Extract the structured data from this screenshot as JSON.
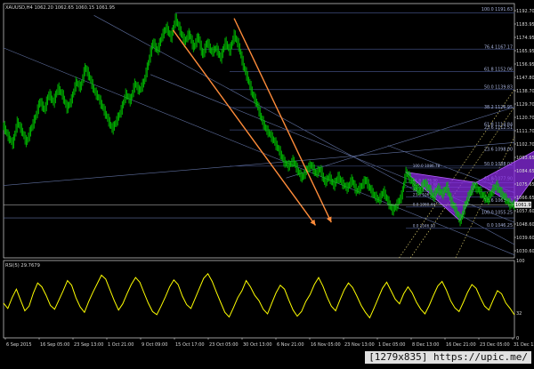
{
  "symbol_header": "XAUUSD,H4 1062.20 1062.65 1060.15 1061.95",
  "rsi_header": "RSI(5) 29.7679",
  "last_price": "1061.95",
  "watermark": "[1279x835] https://upic.me/",
  "colors": {
    "background": "#000000",
    "candle": "#00c000",
    "price_frame": "#d8d8d8",
    "rsi_line": "#ffff00",
    "fib_line": "#3d4a7a",
    "fib_label": "#a9b4dd",
    "trend_line": "#5f6f9f",
    "arrow": "#ff8c3a",
    "pattern_fill": "#8a2be2",
    "pattern_edge": "#b55cff",
    "prz_box": "#0014ff",
    "dotted_channel": "#d2c46a"
  },
  "chart_data": [
    {
      "type": "candlestick",
      "title": "XAUUSD,H4",
      "header_values": {
        "open": 1062.2,
        "high": 1062.65,
        "low": 1060.15,
        "close": 1061.95
      },
      "x_tick_labels": [
        "6 Sep 2015",
        "16 Sep 05:00",
        "23 Sep 13:00",
        "1 Oct 21:00",
        "9 Oct 09:00",
        "15 Oct 17:00",
        "23 Oct 05:00",
        "30 Oct 13:00",
        "6 Nov 21:00",
        "16 Nov 05:00",
        "23 Nov 13:00",
        "1 Dec 05:00",
        "8 Dec 13:00",
        "16 Dec 21:00",
        "23 Dec 05:00",
        "31 Dec 13:00"
      ],
      "y_tick_labels": [
        "1192.70",
        "1183.95",
        "1174.95",
        "1165.95",
        "1156.95",
        "1147.80",
        "1138.70",
        "1129.70",
        "1120.70",
        "1111.70",
        "1102.70",
        "1093.65",
        "1084.65",
        "1075.65",
        "1066.65",
        "1057.60",
        "1048.60",
        "1039.60",
        "1030.60"
      ],
      "ylim": [
        1026,
        1198
      ],
      "close_path": [
        [
          0,
          1115
        ],
        [
          4,
          1108
        ],
        [
          8,
          1103
        ],
        [
          12,
          1118
        ],
        [
          16,
          1112
        ],
        [
          20,
          1104
        ],
        [
          24,
          1113
        ],
        [
          28,
          1121
        ],
        [
          32,
          1132
        ],
        [
          36,
          1126
        ],
        [
          40,
          1137
        ],
        [
          44,
          1131
        ],
        [
          48,
          1141
        ],
        [
          52,
          1136
        ],
        [
          56,
          1127
        ],
        [
          60,
          1133
        ],
        [
          64,
          1145
        ],
        [
          68,
          1141
        ],
        [
          72,
          1155
        ],
        [
          76,
          1148
        ],
        [
          80,
          1139
        ],
        [
          84,
          1134
        ],
        [
          88,
          1127
        ],
        [
          92,
          1120
        ],
        [
          96,
          1113
        ],
        [
          100,
          1119
        ],
        [
          104,
          1126
        ],
        [
          108,
          1137
        ],
        [
          112,
          1132
        ],
        [
          116,
          1144
        ],
        [
          120,
          1139
        ],
        [
          124,
          1145
        ],
        [
          128,
          1158
        ],
        [
          132,
          1172
        ],
        [
          136,
          1166
        ],
        [
          140,
          1176
        ],
        [
          144,
          1182
        ],
        [
          148,
          1175
        ],
        [
          152,
          1188
        ],
        [
          156,
          1180
        ],
        [
          160,
          1172
        ],
        [
          164,
          1178
        ],
        [
          168,
          1168
        ],
        [
          172,
          1176
        ],
        [
          176,
          1163
        ],
        [
          180,
          1172
        ],
        [
          184,
          1165
        ],
        [
          188,
          1168
        ],
        [
          192,
          1161
        ],
        [
          196,
          1172
        ],
        [
          200,
          1166
        ],
        [
          204,
          1177
        ],
        [
          208,
          1169
        ],
        [
          212,
          1156
        ],
        [
          216,
          1147
        ],
        [
          220,
          1137
        ],
        [
          224,
          1130
        ],
        [
          228,
          1120
        ],
        [
          232,
          1113
        ],
        [
          236,
          1109
        ],
        [
          240,
          1104
        ],
        [
          244,
          1098
        ],
        [
          248,
          1091
        ],
        [
          252,
          1088
        ],
        [
          256,
          1092
        ],
        [
          260,
          1085
        ],
        [
          264,
          1080
        ],
        [
          268,
          1086
        ],
        [
          272,
          1089
        ],
        [
          276,
          1083
        ],
        [
          280,
          1086
        ],
        [
          284,
          1077
        ],
        [
          288,
          1081
        ],
        [
          292,
          1075
        ],
        [
          296,
          1081
        ],
        [
          300,
          1076
        ],
        [
          304,
          1073
        ],
        [
          308,
          1079
        ],
        [
          312,
          1071
        ],
        [
          316,
          1074
        ],
        [
          320,
          1079
        ],
        [
          324,
          1073
        ],
        [
          328,
          1068
        ],
        [
          332,
          1065
        ],
        [
          336,
          1071
        ],
        [
          340,
          1064
        ],
        [
          344,
          1058
        ],
        [
          348,
          1062
        ],
        [
          352,
          1068
        ],
        [
          356,
          1084
        ],
        [
          360,
          1079
        ],
        [
          364,
          1074
        ],
        [
          368,
          1071
        ],
        [
          372,
          1077
        ],
        [
          376,
          1073
        ],
        [
          380,
          1067
        ],
        [
          384,
          1073
        ],
        [
          388,
          1069
        ],
        [
          392,
          1074
        ],
        [
          396,
          1064
        ],
        [
          400,
          1058
        ],
        [
          404,
          1051
        ],
        [
          408,
          1061
        ],
        [
          412,
          1069
        ],
        [
          416,
          1075
        ],
        [
          420,
          1072
        ],
        [
          424,
          1068
        ],
        [
          428,
          1065
        ],
        [
          432,
          1071
        ],
        [
          436,
          1075
        ],
        [
          440,
          1070
        ],
        [
          444,
          1066
        ],
        [
          448,
          1062
        ],
        [
          452,
          1061.95
        ]
      ],
      "fibonacci_levels": [
        {
          "label": "100.0 1191.63",
          "price": 1191.63,
          "x_start": 152
        },
        {
          "label": "76.4 1167.17",
          "price": 1167.17,
          "x_start": 176
        },
        {
          "label": "61.8 1152.06",
          "price": 1152.06,
          "x_start": 200
        },
        {
          "label": "50.0 1139.83",
          "price": 1139.83,
          "x_start": 200
        },
        {
          "label": "38.2 1127.62",
          "price": 1127.62,
          "x_start": 200
        },
        {
          "label": "23.6 1112.51",
          "price": 1112.51,
          "x_start": 200
        },
        {
          "label": "0.0 1088.05",
          "price": 1088.05,
          "x_start": 200
        },
        {
          "label": "100.0 1086.78",
          "price": 1086.78,
          "x_start": 356
        },
        {
          "label": "61.8 1076.90",
          "price": 1076.9,
          "x_start": 356
        },
        {
          "label": "50.0 1073.88",
          "price": 1073.88,
          "x_start": 356
        },
        {
          "label": "38.2 1070.85",
          "price": 1070.85,
          "x_start": 356
        },
        {
          "label": "23.6 1067.10",
          "price": 1067.1,
          "x_start": 356
        },
        {
          "label": "0.0 1060.44",
          "price": 1060.44,
          "x_start": 356
        },
        {
          "label": "0.0 1046.00",
          "price": 1046.0,
          "x_start": 356
        }
      ],
      "right_side_labels": [
        {
          "label": "100.0 1191.63",
          "price": 1192.5
        },
        {
          "label": "76.4 1167.17",
          "price": 1167.0
        },
        {
          "label": "61.8 1152.06",
          "price": 1152.0
        },
        {
          "label": "50.0 1139.83",
          "price": 1140.0
        },
        {
          "label": "38.2 1126.95",
          "price": 1126.5
        },
        {
          "label": "61.8 1114.84",
          "price": 1114.8
        },
        {
          "label": "23.6 1112.51",
          "price": 1112.6
        },
        {
          "label": "23.6 1098.00",
          "price": 1098.0
        },
        {
          "label": "50.0 1088.02",
          "price": 1088.0
        },
        {
          "label": "61.8 1077.90",
          "price": 1077.9
        },
        {
          "label": "78.6 1063.43",
          "price": 1063.4
        },
        {
          "label": "100.0 1055.25",
          "price": 1055.3
        },
        {
          "label": "0.0 1046.25",
          "price": 1046.3
        }
      ],
      "prz_box_labels": [
        {
          "label": "61.8 1114.20",
          "price": 1114.2
        },
        {
          "label": "50.0 1114.39",
          "price": 1114.4
        }
      ],
      "harmonic_pattern": {
        "points": [
          [
            356,
            1084
          ],
          [
            404,
            1051
          ],
          [
            418,
            1077
          ],
          [
            452,
            1061.95
          ],
          [
            496,
            1109
          ]
        ]
      }
    },
    {
      "type": "line",
      "title": "RSI(5)",
      "latest_value": 29.7679,
      "y_tick_labels": [
        "100",
        "32",
        "0"
      ],
      "ylim": [
        0,
        100
      ],
      "values": [
        45,
        38,
        52,
        63,
        49,
        35,
        41,
        58,
        71,
        66,
        55,
        42,
        37,
        49,
        61,
        74,
        68,
        52,
        40,
        33,
        47,
        59,
        70,
        81,
        76,
        62,
        48,
        36,
        44,
        57,
        69,
        78,
        72,
        58,
        45,
        34,
        30,
        41,
        53,
        66,
        75,
        69,
        54,
        43,
        38,
        51,
        64,
        77,
        83,
        73,
        59,
        46,
        33,
        27,
        39,
        52,
        61,
        74,
        66,
        55,
        48,
        37,
        31,
        45,
        58,
        68,
        63,
        49,
        36,
        28,
        34,
        47,
        56,
        69,
        78,
        67,
        53,
        41,
        35,
        49,
        62,
        71,
        65,
        54,
        42,
        33,
        26,
        38,
        51,
        64,
        72,
        61,
        50,
        44,
        57,
        66,
        58,
        46,
        37,
        31,
        42,
        55,
        67,
        73,
        62,
        48,
        39,
        34,
        46,
        59,
        69,
        64,
        52,
        41,
        36,
        49,
        61,
        57,
        45,
        38,
        29.77
      ]
    }
  ]
}
